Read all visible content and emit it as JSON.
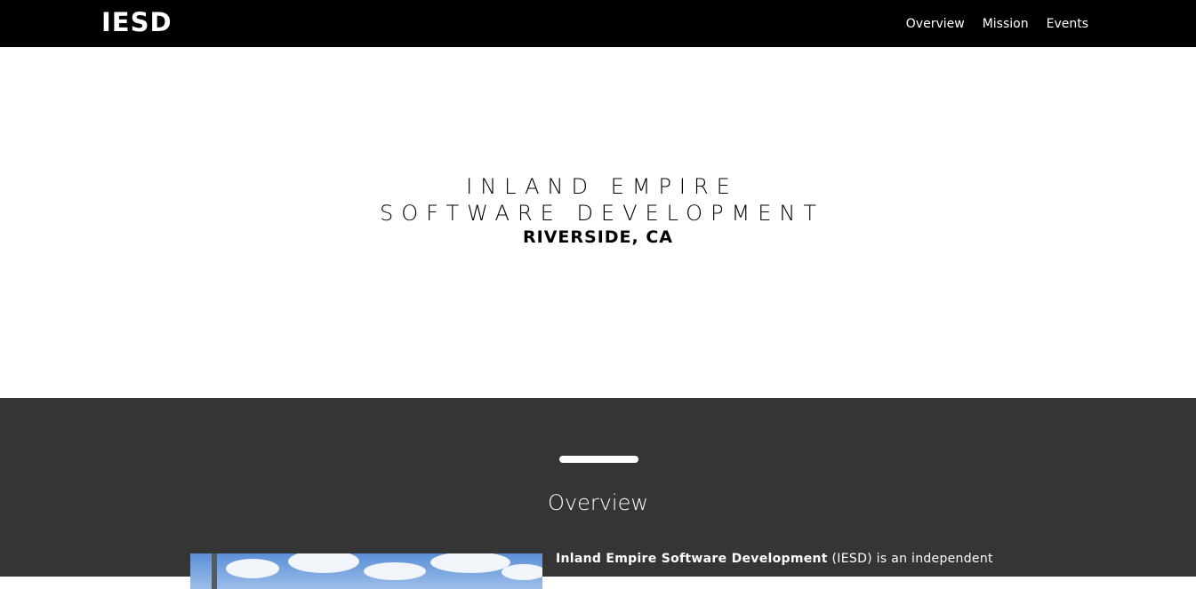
{
  "header": {
    "logo": "IESD",
    "nav": [
      {
        "label": "Overview"
      },
      {
        "label": "Mission"
      },
      {
        "label": "Events"
      }
    ]
  },
  "hero": {
    "line1": "INLAND EMPIRE",
    "line2": "SOFTWARE DEVELOPMENT",
    "line3": "RIVERSIDE, CA"
  },
  "overview": {
    "title": "Overview",
    "intro_bold": "Inland Empire Software Development",
    "intro_rest": " (IESD) is an independent"
  },
  "colors": {
    "topbar": "#000000",
    "hero_bg": "#ffffff",
    "overview_bg": "#353535",
    "text_light": "#ffffff"
  }
}
